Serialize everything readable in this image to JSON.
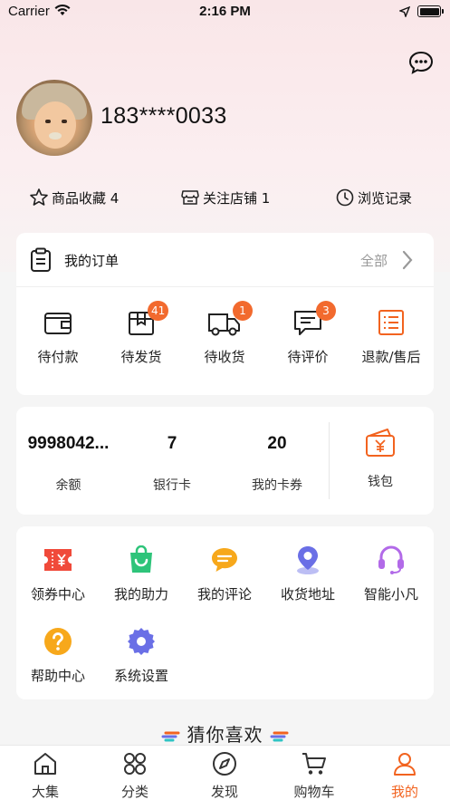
{
  "status_bar": {
    "carrier": "Carrier",
    "time": "2:16 PM"
  },
  "profile": {
    "phone": "183****0033"
  },
  "quick_links": [
    {
      "label": "商品收藏 4",
      "icon": "star-icon"
    },
    {
      "label": "关注店铺 1",
      "icon": "shop-icon"
    },
    {
      "label": "浏览记录",
      "icon": "clock-icon"
    }
  ],
  "orders": {
    "title": "我的订单",
    "all_label": "全部",
    "items": [
      {
        "label": "待付款",
        "icon": "wallet-icon",
        "badge": ""
      },
      {
        "label": "待发货",
        "icon": "box-icon",
        "badge": "41"
      },
      {
        "label": "待收货",
        "icon": "truck-icon",
        "badge": "1"
      },
      {
        "label": "待评价",
        "icon": "comment-icon",
        "badge": "3"
      },
      {
        "label": "退款/售后",
        "icon": "refund-list-icon",
        "badge": ""
      }
    ]
  },
  "wallet": {
    "stats": [
      {
        "value": "9998042...",
        "label": "余额"
      },
      {
        "value": "7",
        "label": "银行卡"
      },
      {
        "value": "20",
        "label": "我的卡券"
      }
    ],
    "wallet_label": "钱包"
  },
  "services": [
    {
      "label": "领券中心",
      "icon": "coupon-icon"
    },
    {
      "label": "我的助力",
      "icon": "shopping-bag-icon"
    },
    {
      "label": "我的评论",
      "icon": "chat-bubble-icon"
    },
    {
      "label": "收货地址",
      "icon": "location-pin-icon"
    },
    {
      "label": "智能小凡",
      "icon": "headset-icon"
    },
    {
      "label": "帮助中心",
      "icon": "help-icon"
    },
    {
      "label": "系统设置",
      "icon": "settings-gear-icon"
    }
  ],
  "guess_title": "猜你喜欢",
  "tabs": [
    {
      "label": "大集",
      "icon": "home-icon",
      "active": false
    },
    {
      "label": "分类",
      "icon": "category-icon",
      "active": false
    },
    {
      "label": "发现",
      "icon": "compass-icon",
      "active": false
    },
    {
      "label": "购物车",
      "icon": "cart-icon",
      "active": false
    },
    {
      "label": "我的",
      "icon": "user-icon",
      "active": true
    }
  ],
  "colors": {
    "accent": "#f2631f",
    "badge": "#f26a2e",
    "hero_bg": "#f9e6e8"
  }
}
